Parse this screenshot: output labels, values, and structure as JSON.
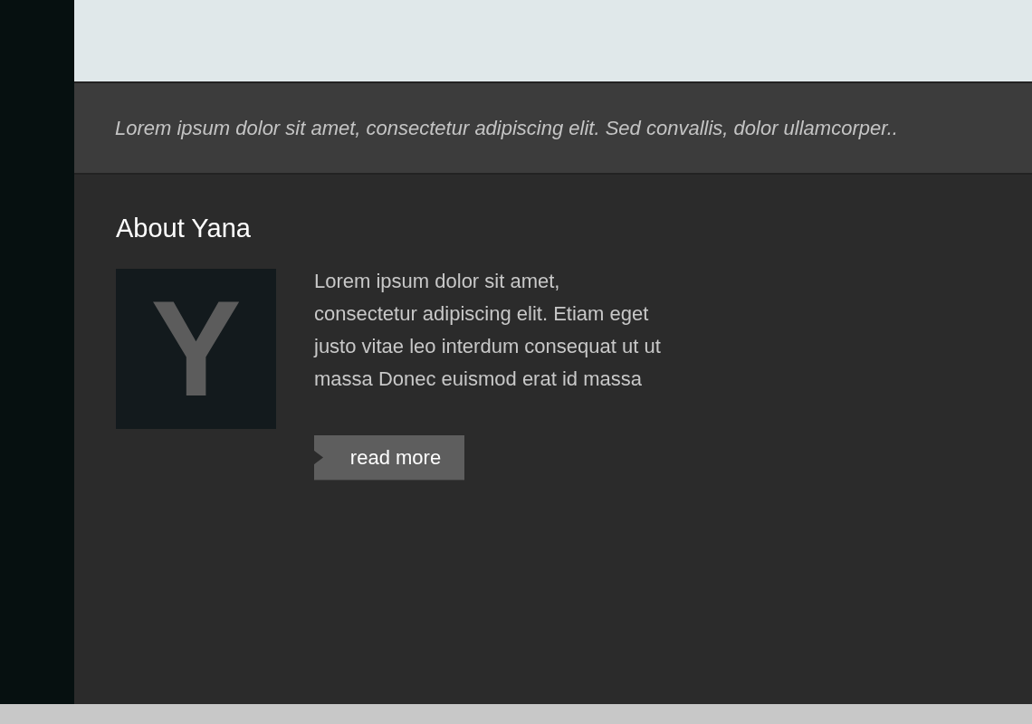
{
  "tagline": "Lorem ipsum dolor sit amet, consectetur adipiscing elit. Sed convallis, dolor ullamcorper..",
  "about": {
    "title": "About Yana",
    "logo_letter": "Y",
    "text": "Lorem ipsum dolor sit amet, consectetur adipiscing elit. Etiam eget justo vitae leo interdum consequat ut ut massa Donec euismod erat id massa",
    "button": "read more"
  }
}
